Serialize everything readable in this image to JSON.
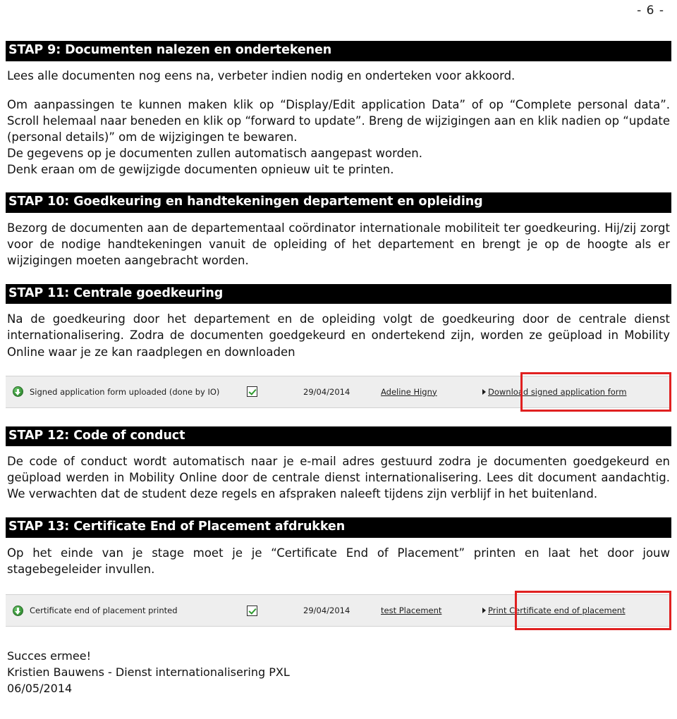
{
  "page": {
    "page_number": "- 6 -"
  },
  "steps": [
    {
      "heading": "STAP 9: Documenten nalezen en ondertekenen",
      "paragraphs": [
        "Lees alle documenten nog eens na, verbeter indien nodig en onderteken voor akkoord.",
        "Om aanpassingen te kunnen maken klik op “Display/Edit application Data” of op “Complete personal data”. Scroll helemaal naar beneden en klik op “forward to update”. Breng de wijzigingen aan en klik nadien op “update (personal details)” om de wijzigingen te bewaren.",
        "De gegevens op je documenten zullen automatisch aangepast worden.",
        "Denk eraan om de gewijzigde documenten opnieuw uit te printen."
      ]
    },
    {
      "heading": "STAP 10: Goedkeuring en handtekeningen departement en opleiding",
      "paragraphs": [
        "Bezorg de documenten aan de departementaal coördinator internationale mobiliteit ter goedkeuring. Hij/zij zorgt voor de nodige handtekeningen vanuit de opleiding of het departement en brengt je op de hoogte als er wijzigingen moeten aangebracht worden."
      ]
    },
    {
      "heading": "STAP 11: Centrale goedkeuring",
      "paragraphs": [
        "Na de goedkeuring door het departement en de opleiding volgt de goedkeuring door de centrale dienst internationalisering. Zodra de documenten goedgekeurd en ondertekend zijn, worden ze geüpload in Mobility Online waar je ze kan raadplegen en downloaden"
      ]
    },
    {
      "heading": "STAP 12: Code of conduct",
      "paragraphs": [
        "De code of conduct wordt automatisch naar je e-mail adres gestuurd zodra je documenten goedgekeurd en geüpload werden in Mobility Online door de centrale dienst internationalisering. Lees dit document aandachtig. We verwachten dat de student deze regels en afspraken naleeft tijdens zijn verblijf in het buitenland."
      ]
    },
    {
      "heading": "STAP 13: Certificate End of Placement afdrukken",
      "paragraphs": [
        "Op het einde van je stage moet je je “Certificate End of Placement” printen en laat het door jouw stagebegeleider invullen."
      ]
    }
  ],
  "widgets": [
    {
      "download_icon": "download-circle-icon",
      "label": "Signed application form uploaded (done by IO)",
      "checkbox": "checked-checkbox-icon",
      "date": "29/04/2014",
      "user": "Adeline Higny",
      "bullet_icon": "triangle-bullet-icon",
      "action_link": "Download signed application form",
      "highlight_color": "#e02020"
    },
    {
      "download_icon": "download-circle-icon",
      "label": "Certificate end of placement printed",
      "checkbox": "checked-checkbox-icon",
      "date": "29/04/2014",
      "user": "test Placement",
      "bullet_icon": "triangle-bullet-icon",
      "action_link": "Print Certificate end of placement",
      "highlight_color": "#e02020"
    }
  ],
  "footer": {
    "line1": "Succes ermee!",
    "line2": "Kristien Bauwens - Dienst internationalisering PXL",
    "line3": "06/05/2014"
  }
}
